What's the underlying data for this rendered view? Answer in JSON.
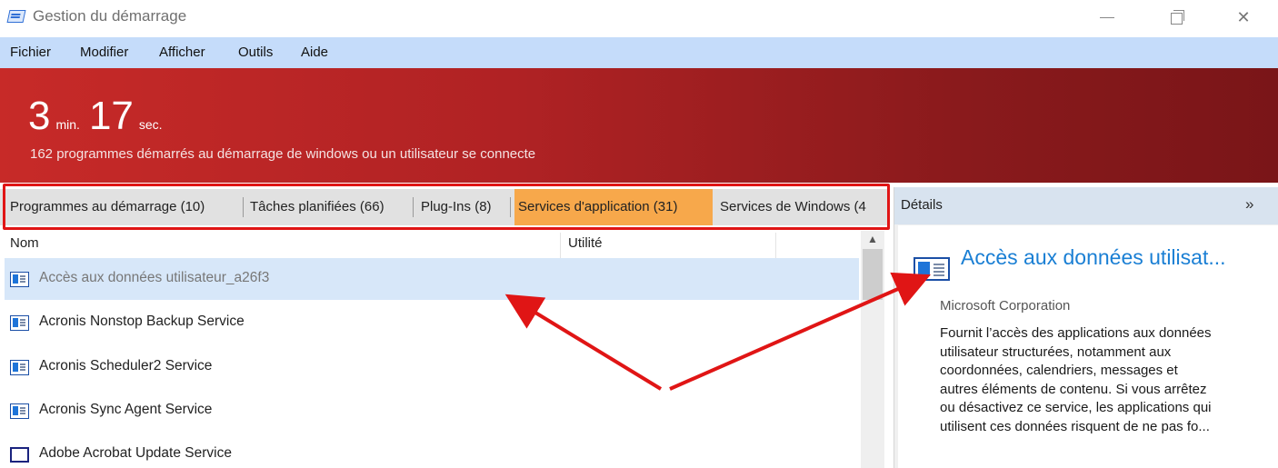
{
  "window": {
    "title": "Gestion du démarrage",
    "controls": {
      "minimize": "minimize-icon",
      "maximize": "maximize-icon",
      "close": "close-icon"
    }
  },
  "menu": {
    "items": [
      "Fichier",
      "Modifier",
      "Afficher",
      "Outils",
      "Aide"
    ]
  },
  "banner": {
    "minutes": "3",
    "min_label": "min.",
    "seconds": "17",
    "sec_label": "sec.",
    "subtitle": "162 programmes démarrés au démarrage de windows ou un utilisateur se connecte",
    "color": "#b02224"
  },
  "tabs": {
    "items": [
      {
        "label": "Programmes au démarrage (10)",
        "active": false
      },
      {
        "label": "Tâches planifiées (66)",
        "active": false
      },
      {
        "label": "Plug-Ins (8)",
        "active": false
      },
      {
        "label": "Services d'application (31)",
        "active": true
      },
      {
        "label": "Services de Windows (4",
        "active": false
      }
    ],
    "active_color": "#f7a84b"
  },
  "list": {
    "columns": [
      "Nom",
      "Utilité"
    ],
    "rows": [
      {
        "name": "Accès aux données utilisateur_a26f3",
        "icon": "service-icon",
        "selected": true
      },
      {
        "name": "Acronis Nonstop Backup Service",
        "icon": "service-icon",
        "selected": false
      },
      {
        "name": "Acronis Scheduler2 Service",
        "icon": "service-icon",
        "selected": false
      },
      {
        "name": "Acronis Sync Agent Service",
        "icon": "service-icon",
        "selected": false
      },
      {
        "name": "Adobe Acrobat Update Service",
        "icon": "window-icon",
        "selected": false
      }
    ]
  },
  "details": {
    "header": "Détails",
    "collapse_icon": "»",
    "name": "Accès aux données utilisat...",
    "company": "Microsoft Corporation",
    "description_lines": [
      "Fournit l’accès des applications aux données",
      "utilisateur structurées, notamment aux",
      "coordonnées, calendriers, messages et",
      "autres éléments de contenu. Si vous arrêtez",
      "ou désactivez ce service, les applications qui",
      "utilisent ces données risquent de ne pas fo..."
    ]
  },
  "annotation": {
    "color": "#e01515"
  }
}
